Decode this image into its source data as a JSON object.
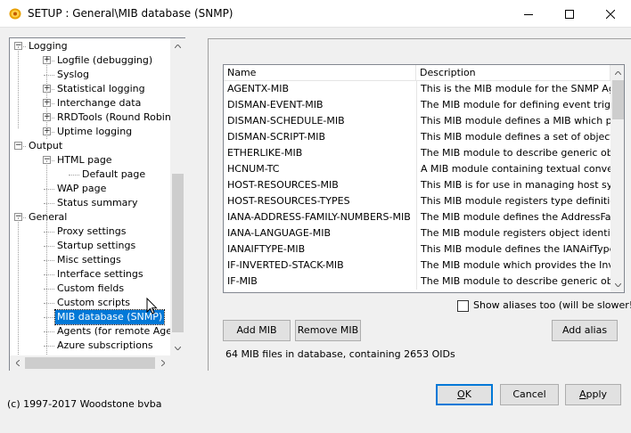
{
  "window": {
    "title": "SETUP : General\\MIB database (SNMP)",
    "icons": {
      "app": "app-logo-icon",
      "minimize": "minimize-icon",
      "maximize": "maximize-icon",
      "close": "close-icon"
    }
  },
  "tree": {
    "items": [
      {
        "label": "Logging",
        "level": 0,
        "expander": "-"
      },
      {
        "label": "Logfile (debugging)",
        "level": 1,
        "expander": "+"
      },
      {
        "label": "Syslog",
        "level": 1,
        "expander": ""
      },
      {
        "label": "Statistical logging",
        "level": 1,
        "expander": "+"
      },
      {
        "label": "Interchange data",
        "level": 1,
        "expander": "+"
      },
      {
        "label": "RRDTools (Round Robin Database)",
        "level": 1,
        "expander": "+"
      },
      {
        "label": "Uptime logging",
        "level": 1,
        "expander": "+"
      },
      {
        "label": "Output",
        "level": 0,
        "expander": "-"
      },
      {
        "label": "HTML page",
        "level": 1,
        "expander": "-"
      },
      {
        "label": "Default page",
        "level": 2,
        "expander": ""
      },
      {
        "label": "WAP page",
        "level": 1,
        "expander": ""
      },
      {
        "label": "Status summary",
        "level": 1,
        "expander": ""
      },
      {
        "label": "General",
        "level": 0,
        "expander": "-"
      },
      {
        "label": "Proxy settings",
        "level": 1,
        "expander": ""
      },
      {
        "label": "Startup settings",
        "level": 1,
        "expander": ""
      },
      {
        "label": "Misc settings",
        "level": 1,
        "expander": ""
      },
      {
        "label": "Interface settings",
        "level": 1,
        "expander": ""
      },
      {
        "label": "Custom fields",
        "level": 1,
        "expander": ""
      },
      {
        "label": "Custom scripts",
        "level": 1,
        "expander": ""
      },
      {
        "label": "MIB database (SNMP)",
        "level": 1,
        "expander": "",
        "selected": true
      },
      {
        "label": "Agents (for remote Agents)",
        "level": 1,
        "expander": ""
      },
      {
        "label": "Azure subscriptions",
        "level": 1,
        "expander": ""
      }
    ]
  },
  "mib_table": {
    "columns": [
      "Name",
      "Description"
    ],
    "rows": [
      [
        "AGENTX-MIB",
        "This is the MIB module for the SNMP Agent Extensibility Protocol"
      ],
      [
        "DISMAN-EVENT-MIB",
        "The MIB module for defining event triggers and actions"
      ],
      [
        "DISMAN-SCHEDULE-MIB",
        "This MIB module defines a MIB which provides mechanisms to schedule"
      ],
      [
        "DISMAN-SCRIPT-MIB",
        "This MIB module defines a set of objects that allow to delegate"
      ],
      [
        "ETHERLIKE-MIB",
        "The MIB module to describe generic objects for ethernet-like"
      ],
      [
        "HCNUM-TC",
        "A MIB module containing textual conventions for high capacity"
      ],
      [
        "HOST-RESOURCES-MIB",
        "This MIB is for use in managing host systems"
      ],
      [
        "HOST-RESOURCES-TYPES",
        "This MIB module registers type definitions for storage types"
      ],
      [
        "IANA-ADDRESS-FAMILY-NUMBERS-MIB",
        "The MIB module defines the AddressFamilyNumbers"
      ],
      [
        "IANA-LANGUAGE-MIB",
        "The MIB module registers object identifier values"
      ],
      [
        "IANAIFTYPE-MIB",
        "This MIB module defines the IANAifType Textual Convention"
      ],
      [
        "IF-INVERTED-STACK-MIB",
        "The MIB module which provides the Inverted Stack Table"
      ],
      [
        "IF-MIB",
        "The MIB module to describe generic objects for network interface"
      ]
    ]
  },
  "show_aliases": {
    "label": "Show aliases too (will be slower!)",
    "checked": false
  },
  "buttons": {
    "add_mib": "Add MIB",
    "remove_mib": "Remove MIB",
    "add_alias": "Add alias",
    "ok_mnemonic": "O",
    "ok_rest": "K",
    "cancel": "Cancel",
    "apply_mnemonic": "A",
    "apply_rest": "pply"
  },
  "status": "64 MIB files in database, containing  2653 OIDs",
  "copyright": "(c) 1997-2017 Woodstone bvba",
  "scroll_icons": {
    "up": "scroll-up-arrow-icon",
    "down": "scroll-down-arrow-icon"
  }
}
